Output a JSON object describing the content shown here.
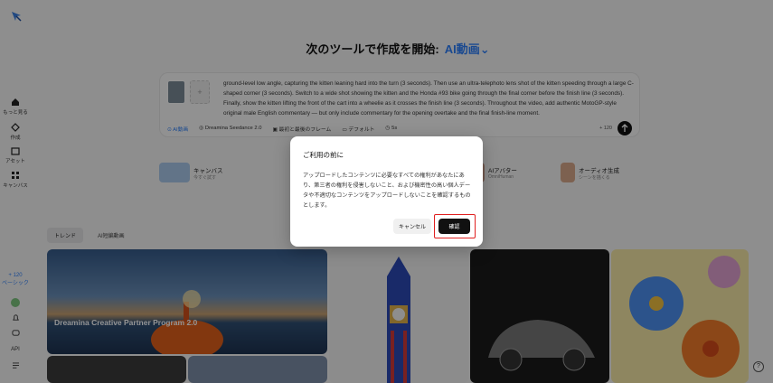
{
  "sidebar": {
    "items": [
      {
        "label": "もっと見る",
        "icon": "home-icon"
      },
      {
        "label": "作成",
        "icon": "sparkle-icon"
      },
      {
        "label": "アセット",
        "icon": "folder-icon"
      },
      {
        "label": "キャンバス",
        "icon": "canvas-icon"
      }
    ],
    "upgrade_top": "+ 120",
    "upgrade_bottom": "ベーシック",
    "api_label": "API"
  },
  "header": {
    "title": "次のツールで作成を開始:",
    "mode": "AI動画"
  },
  "prompt": {
    "text": "ground-level low angle, capturing the kitten leaning hard into the turn (3 seconds). Then use an ultra-telephoto lens shot of the kitten speeding through a large C-shaped corner (3 seconds). Switch to a wide shot showing the kitten and the Honda #93 bike going through the final corner before the finish line (3 seconds). Finally, show the kitten lifting the front of the cart into a wheelie as it crosses the finish line (3 seconds). Throughout the video, add authentic MotoGP-style original male English commentary — but only include commentary for the opening overtake and the final finish-line moment.",
    "toolbar": {
      "mode": "AI動画",
      "model": "Dreamina Seedance 2.0",
      "frames": "最初と最後のフレーム",
      "ratio": "デフォルト",
      "duration": "5s"
    },
    "credits": "+ 120"
  },
  "tools": [
    {
      "name": "キャンバス",
      "sub": "今すぐ試す"
    },
    {
      "name": "AIアバター",
      "sub": "OmniHuman"
    },
    {
      "name": "オーディオ生成",
      "sub": "シーンを描くる"
    }
  ],
  "tabs": [
    "トレンド",
    "AI短編動画"
  ],
  "gallery": {
    "promo_title": "Dreamina Creative Partner Program 2.0"
  },
  "modal": {
    "title": "ご利用の前に",
    "body": "アップロードしたコンテンツに必要なすべての権利があなたにあり、第三者の権利を侵害しないこと、および機密性の高い個人データや不適切なコンテンツをアップロードしないことを確認するものとします。",
    "cancel": "キャンセル",
    "confirm": "確認"
  },
  "colors": {
    "accent": "#2d7ff9",
    "highlight": "#e02020"
  }
}
